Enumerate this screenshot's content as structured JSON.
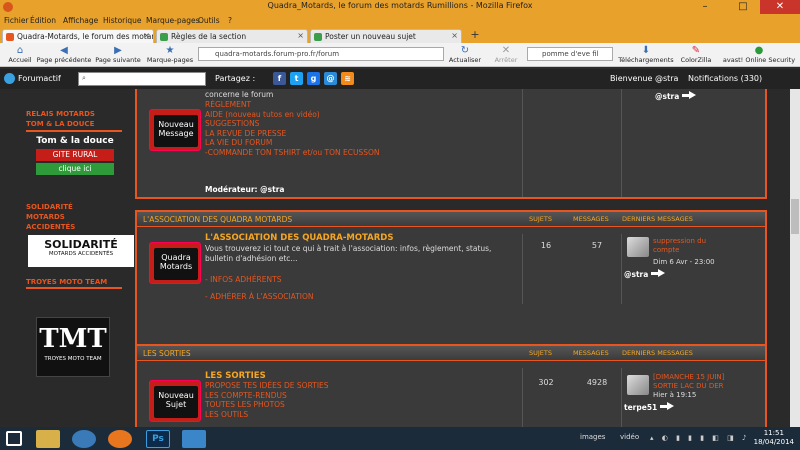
{
  "window": {
    "title": "Quadra_Motards, le forum des motards Rumillions - Mozilla Firefox",
    "minimize": "–",
    "maximize": "□",
    "close": "✕"
  },
  "menu": [
    "Fichier",
    "Édition",
    "Affichage",
    "Historique",
    "Marque-pages",
    "Outils",
    "?"
  ],
  "tabs": [
    {
      "label": "Quadra-Motards, le forum des motards ...",
      "active": true
    },
    {
      "label": "Règles de la section",
      "active": false
    },
    {
      "label": "Poster un nouveau sujet",
      "active": false
    }
  ],
  "new_tab": "+",
  "nav": {
    "home": "Accueil",
    "back": "Page précédente",
    "forward": "Page suivante",
    "bookmarks": "Marque-pages",
    "url": "quadra-motards.forum-pro.fr/forum",
    "reload": "Actualiser",
    "stop": "Arrêter",
    "search": "pomme d'eve fil",
    "downloads": "Téléchargements",
    "colorzilla": "ColorZilla",
    "avast": "avast! Online Security"
  },
  "forumactif": {
    "brand": "Forumactif",
    "share": "Partagez :",
    "welcome": "Bienvenue @stra",
    "notifications": "Notifications (330)"
  },
  "sidebar": {
    "relais_title_1": "RELAIS MOTARDS",
    "relais_title_2": "TOM & LA DOUCE",
    "relais_banner_title": "Tom & la douce",
    "relais_banner_sub": "GITE RURAL",
    "relais_banner_click": "clique ici",
    "solidarite_1": "SOLIDARITÉ",
    "solidarite_2": "MOTARDS",
    "solidarite_3": "ACCIDENTÉS",
    "solidarite_logo": "SOLIDARITÉ",
    "solidarite_logo_sub": "MOTARDS ACCIDENTÉS",
    "troyes_title": "TROYES MOTO TEAM",
    "tmt_logo": "TMT",
    "tmt_sub": "TROYES MOTO TEAM"
  },
  "block1": {
    "desc_top": "concerne le forum",
    "links": [
      "RÈGLEMENT",
      "AIDE (nouveau tutos en vidéo)",
      "SUGGESTIONS",
      "LA REVUE DE PRESSE",
      "LA VIE DU FORUM",
      "-COMMANDE TON TSHIRT et/ou TON ECUSSON"
    ],
    "moderator": "Modérateur: @stra",
    "last_user": "@stra",
    "icon_line1": "Nouveau",
    "icon_line2": "Message"
  },
  "block2": {
    "category": "L'ASSOCIATION DES QUADRA MOTARDS",
    "col_topics": "SUJETS",
    "col_messages": "MESSAGES",
    "col_last": "DERNIERS MESSAGES",
    "title": "L'ASSOCIATION DES QUADRA-MOTARDS",
    "desc": "Vous trouverez ici tout ce qui à trait à l'association: infos, règlement, status, bulletin d'adhésion etc...",
    "sub1": "- INFOS ADHÉRENTS",
    "sub2": "- ADHÉRER À L'ASSOCIATION",
    "topics": "16",
    "messages": "57",
    "last_title": "suppression du compte",
    "last_date": "Dim 6 Avr - 23:00",
    "last_user": "@stra",
    "icon_line1": "Quadra",
    "icon_line2": "Motards"
  },
  "block3": {
    "category": "LES SORTIES",
    "col_topics": "SUJETS",
    "col_messages": "MESSAGES",
    "col_last": "DERNIERS MESSAGES",
    "title": "LES SORTIES",
    "links": [
      "PROPOSE TES IDÉES DE SORTIES",
      "LES COMPTE-RENDUS",
      "TOUTES LES PHOTOS",
      "LES OUTILS"
    ],
    "topics": "302",
    "messages": "4928",
    "last_title": "[DIMANCHE 15 JUIN] SORTIE LAC DU DER",
    "last_date": "Hier à 19:15",
    "last_user": "terpe51",
    "icon_line1": "Nouveau",
    "icon_line2": "Sujet"
  },
  "taskbar": {
    "images": "images",
    "video": "vidéo",
    "time": "11:51",
    "date": "18/04/2014",
    "ps": "Ps"
  },
  "colors": {
    "accent": "#e8551e",
    "gold": "#f5a623",
    "firefox": "#e8a12a"
  }
}
